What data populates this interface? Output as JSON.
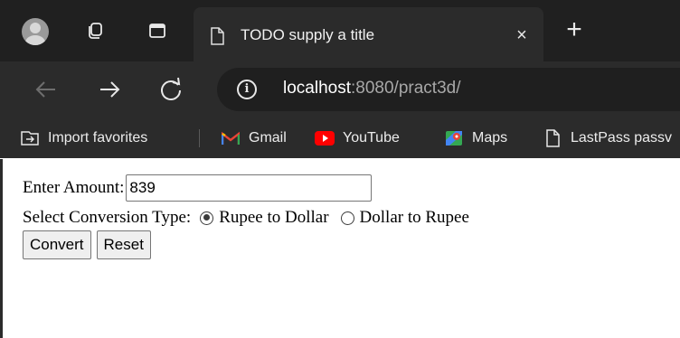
{
  "tab": {
    "title": "TODO supply a title",
    "close_glyph": "×",
    "new_tab_glyph": "+"
  },
  "toolbar": {
    "url_host": "localhost",
    "url_rest": ":8080/pract3d/",
    "info_glyph": "i"
  },
  "favorites": {
    "items": [
      {
        "label": "Import favorites",
        "icon": "import-favorites-icon"
      },
      {
        "label": "Gmail",
        "icon": "gmail-icon"
      },
      {
        "label": "YouTube",
        "icon": "youtube-icon"
      },
      {
        "label": "Maps",
        "icon": "maps-icon"
      },
      {
        "label": "LastPass passv",
        "icon": "page-icon"
      }
    ]
  },
  "form": {
    "amount_label": "Enter Amount:",
    "amount_value": "839",
    "conversion_label": "Select Conversion Type:",
    "option_rupee_to_dollar": "Rupee to Dollar",
    "option_dollar_to_rupee": "Dollar to Rupee",
    "selected_option": "Rupee to Dollar",
    "convert_label": "Convert",
    "reset_label": "Reset"
  },
  "colors": {
    "chrome_dark": "#202020",
    "chrome_bar": "#2b2b2b",
    "youtube_red": "#ff0000"
  }
}
